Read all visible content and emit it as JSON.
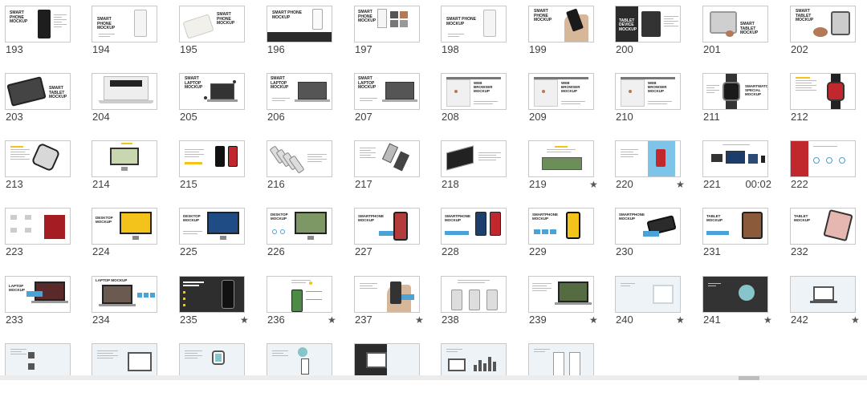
{
  "slides": [
    {
      "num": "193",
      "t": "SMART\nPHONE\nMOCKUP",
      "k": "phone-dark"
    },
    {
      "num": "194",
      "t": "SMART\nPHONE\nMOCKUP",
      "k": "phone-white"
    },
    {
      "num": "195",
      "t": "SMART\nPHONE\nMOCKUP",
      "k": "phone-flat"
    },
    {
      "num": "196",
      "t": "SMART PHONE\nMOCKUP",
      "k": "phone-stats"
    },
    {
      "num": "197",
      "t": "SMART\nPHONE\nMOCKUP",
      "k": "phone-grid"
    },
    {
      "num": "198",
      "t": "SMART PHONE\nMOCKUP",
      "k": "phone-white"
    },
    {
      "num": "199",
      "t": "SMART\nPHONE\nMOCKUP",
      "k": "phone-hand"
    },
    {
      "num": "200",
      "t": "TABLET\nDEVICE\nMOCKUP",
      "k": "tablet-dark"
    },
    {
      "num": "201",
      "t": "SMART\nTABLET\nMOCKUP",
      "k": "tablet-flat"
    },
    {
      "num": "202",
      "t": "SMART\nTABLET\nMOCKUP",
      "k": "tablet-brown"
    },
    {
      "num": "203",
      "t": "SMART\nTABLET\nMOCKUP",
      "k": "tablet-angle"
    },
    {
      "num": "204",
      "t": "",
      "k": "laptop-banner"
    },
    {
      "num": "205",
      "t": "SMART\nLAPTOP\nMOCKUP",
      "k": "laptop-dots"
    },
    {
      "num": "206",
      "t": "SMART\nLAPTOP\nMOCKUP",
      "k": "laptop"
    },
    {
      "num": "207",
      "t": "SMART\nLAPTOP\nMOCKUP",
      "k": "laptop"
    },
    {
      "num": "208",
      "t": "WEB\nBROWSER\nMOCKUP",
      "k": "browser"
    },
    {
      "num": "209",
      "t": "WEB\nBROWSER\nMOCKUP",
      "k": "browser"
    },
    {
      "num": "210",
      "t": "WEB\nBROWSER\nMOCKUP",
      "k": "browser"
    },
    {
      "num": "211",
      "t": "SMARTWATCH\nSPECIAL\nMOCKUP",
      "k": "watch"
    },
    {
      "num": "212",
      "t": "",
      "k": "watch-red"
    },
    {
      "num": "213",
      "t": "",
      "k": "watch-side"
    },
    {
      "num": "214",
      "t": "",
      "k": "imac-yellow"
    },
    {
      "num": "215",
      "t": "",
      "k": "phones-red"
    },
    {
      "num": "216",
      "t": "",
      "k": "phones-stack"
    },
    {
      "num": "217",
      "t": "",
      "k": "phones-tilt"
    },
    {
      "num": "218",
      "t": "",
      "k": "laptop-tilt"
    },
    {
      "num": "219",
      "t": "",
      "k": "laptop-green",
      "star": "★"
    },
    {
      "num": "220",
      "t": "",
      "k": "hand-blue",
      "star": "★"
    },
    {
      "num": "221",
      "t": "",
      "k": "responsive",
      "timing": "00:02"
    },
    {
      "num": "222",
      "t": "",
      "k": "app-sample"
    },
    {
      "num": "223",
      "t": "",
      "k": "icons-red"
    },
    {
      "num": "224",
      "t": "DESKTOP\nMOCKUP",
      "k": "imac-yellow2"
    },
    {
      "num": "225",
      "t": "DESKTOP\nMOCKUP",
      "k": "imac-blue"
    },
    {
      "num": "226",
      "t": "DESKTOP\nMOCKUP",
      "k": "imac-forest"
    },
    {
      "num": "227",
      "t": "SMARTPHONE\nMOCKUP",
      "k": "phone-woman"
    },
    {
      "num": "228",
      "t": "SMARTPHONE\nMOCKUP",
      "k": "phones-pair"
    },
    {
      "num": "229",
      "t": "SMARTPHONE\nMOCKUP",
      "k": "phone-yellow"
    },
    {
      "num": "230",
      "t": "SMARTPHONE\nMOCKUP",
      "k": "phone-landscape"
    },
    {
      "num": "231",
      "t": "TABLET\nMOCKUP",
      "k": "tablet-cat"
    },
    {
      "num": "232",
      "t": "TABLET\nMOCKUP",
      "k": "tablet-pink"
    },
    {
      "num": "233",
      "t": "LAPTOP\nMOCKUP",
      "k": "laptop-red"
    },
    {
      "num": "234",
      "t": "LAPTOP MOCKUP",
      "k": "laptop-plain"
    },
    {
      "num": "235",
      "t": "",
      "k": "dark-phone",
      "star": "★"
    },
    {
      "num": "236",
      "t": "",
      "k": "phone-leaf",
      "star": "★"
    },
    {
      "num": "237",
      "t": "",
      "k": "hand-phone",
      "star": "★"
    },
    {
      "num": "238",
      "t": "",
      "k": "phones-three"
    },
    {
      "num": "239",
      "t": "",
      "k": "laptop-forest",
      "star": "★"
    },
    {
      "num": "240",
      "t": "",
      "k": "wire-light",
      "star": "★"
    },
    {
      "num": "241",
      "t": "",
      "k": "wire-dark",
      "star": "★"
    },
    {
      "num": "242",
      "t": "",
      "k": "wire-laptop",
      "star": "★"
    },
    {
      "num": "",
      "t": "",
      "k": "wire-a"
    },
    {
      "num": "",
      "t": "",
      "k": "wire-b"
    },
    {
      "num": "",
      "t": "",
      "k": "wire-c"
    },
    {
      "num": "",
      "t": "",
      "k": "wire-d"
    },
    {
      "num": "",
      "t": "",
      "k": "wire-e"
    },
    {
      "num": "",
      "t": "",
      "k": "wire-f"
    },
    {
      "num": "",
      "t": "",
      "k": "wire-g"
    },
    {
      "num": "",
      "t": "",
      "k": "wire-h"
    }
  ],
  "colors": {
    "accent_blue": "#4aa3d8",
    "accent_yellow": "#f3c21b",
    "accent_brown": "#b27a56",
    "accent_red": "#c0282d",
    "accent_teal": "#86c5c9",
    "dark": "#2b2b2b"
  }
}
